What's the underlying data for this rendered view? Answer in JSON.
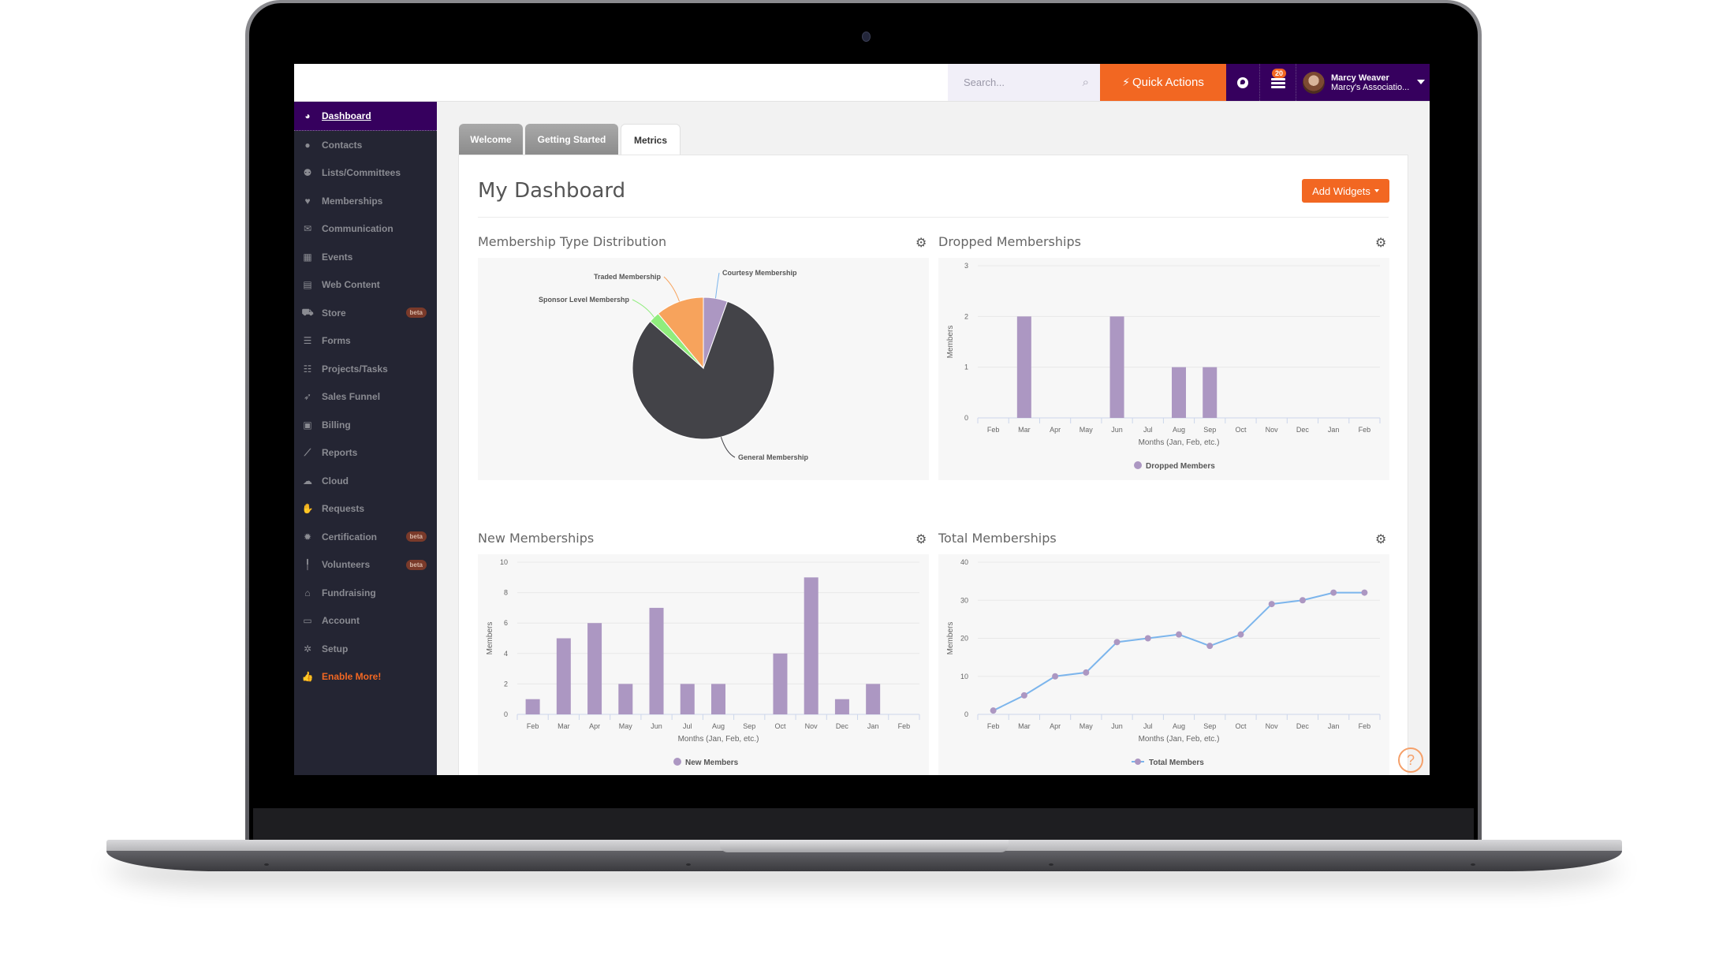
{
  "header": {
    "search_placeholder": "Search...",
    "search_icon": "magnifier-icon",
    "quick_actions_label": "Quick Actions",
    "quick_actions_icon": "bolt-icon",
    "globe_icon": "globe-icon",
    "notifications_icon": "tasks-stack-icon",
    "notifications_count": "20",
    "user": {
      "name": "Marcy Weaver",
      "organization": "Marcy's Associatio..."
    },
    "colors": {
      "accent": "#f26722",
      "brand": "#36005e"
    }
  },
  "sidebar": {
    "items": [
      {
        "label": "Dashboard",
        "icon": "dashboard-gauge-icon",
        "glyph": "◕",
        "active": true
      },
      {
        "label": "Contacts",
        "icon": "user-icon",
        "glyph": "●"
      },
      {
        "label": "Lists/Committees",
        "icon": "users-icon",
        "glyph": "⚉"
      },
      {
        "label": "Memberships",
        "icon": "heart-icon",
        "glyph": "♥"
      },
      {
        "label": "Communication",
        "icon": "envelope-icon",
        "glyph": "✉"
      },
      {
        "label": "Events",
        "icon": "calendar-icon",
        "glyph": "▦"
      },
      {
        "label": "Web Content",
        "icon": "newspaper-icon",
        "glyph": "▤"
      },
      {
        "label": "Store",
        "icon": "cart-icon",
        "glyph": "⛟",
        "badge": "beta"
      },
      {
        "label": "Forms",
        "icon": "list-icon",
        "glyph": "☰"
      },
      {
        "label": "Projects/Tasks",
        "icon": "tasks-icon",
        "glyph": "☷"
      },
      {
        "label": "Sales Funnel",
        "icon": "rocket-icon",
        "glyph": "➶"
      },
      {
        "label": "Billing",
        "icon": "money-icon",
        "glyph": "▣"
      },
      {
        "label": "Reports",
        "icon": "line-chart-icon",
        "glyph": "⟋"
      },
      {
        "label": "Cloud",
        "icon": "cloud-icon",
        "glyph": "☁"
      },
      {
        "label": "Requests",
        "icon": "hand-icon",
        "glyph": "✋"
      },
      {
        "label": "Certification",
        "icon": "certificate-icon",
        "glyph": "✹",
        "badge": "beta"
      },
      {
        "label": "Volunteers",
        "icon": "volunteer-icon",
        "glyph": "╿",
        "badge": "beta"
      },
      {
        "label": "Fundraising",
        "icon": "gift-icon",
        "glyph": "⌂"
      },
      {
        "label": "Account",
        "icon": "credit-card-icon",
        "glyph": "▭"
      },
      {
        "label": "Setup",
        "icon": "gear-icon",
        "glyph": "✲"
      },
      {
        "label": "Enable More!",
        "icon": "thumbs-up-icon",
        "glyph": "👍",
        "highlight": true
      }
    ]
  },
  "tabs": [
    {
      "label": "Welcome",
      "active": false
    },
    {
      "label": "Getting Started",
      "active": false
    },
    {
      "label": "Metrics",
      "active": true
    }
  ],
  "main": {
    "title": "My Dashboard",
    "add_widgets_label": "Add Widgets",
    "help_label": "?"
  },
  "chart_data": [
    {
      "type": "pie",
      "title": "Membership Type Distribution",
      "slices": [
        {
          "label": "Courtesy Membership",
          "value": 5.5,
          "color": "#ac97c2"
        },
        {
          "label": "General Membership",
          "value": 81,
          "color": "#434348"
        },
        {
          "label": "Sponsor Level Membershp",
          "value": 2.5,
          "color": "#90ed7d"
        },
        {
          "label": "Traded Membership",
          "value": 11,
          "color": "#f7a35c"
        }
      ]
    },
    {
      "type": "bar",
      "title": "Dropped Memberships",
      "categories": [
        "Feb",
        "Mar",
        "Apr",
        "May",
        "Jun",
        "Jul",
        "Aug",
        "Sep",
        "Oct",
        "Nov",
        "Dec",
        "Jan",
        "Feb"
      ],
      "series": [
        {
          "name": "Dropped Members",
          "values": [
            0,
            2,
            0,
            0,
            2,
            0,
            1,
            1,
            0,
            0,
            0,
            0,
            0
          ],
          "color": "#ac97c2"
        }
      ],
      "xlabel": "Months (Jan, Feb, etc.)",
      "ylabel": "Members",
      "ylim": [
        0,
        3
      ],
      "yticks": [
        0,
        1,
        2,
        3
      ],
      "grid": true,
      "legend": "bottom-center"
    },
    {
      "type": "bar",
      "title": "New Memberships",
      "categories": [
        "Feb",
        "Mar",
        "Apr",
        "May",
        "Jun",
        "Jul",
        "Aug",
        "Sep",
        "Oct",
        "Nov",
        "Dec",
        "Jan",
        "Feb"
      ],
      "series": [
        {
          "name": "New Members",
          "values": [
            1,
            5,
            6,
            2,
            7,
            2,
            2,
            0,
            4,
            9,
            1,
            2,
            0
          ],
          "color": "#ac97c2"
        }
      ],
      "xlabel": "Months (Jan, Feb, etc.)",
      "ylabel": "Members",
      "ylim": [
        0,
        10
      ],
      "yticks": [
        0,
        2,
        4,
        6,
        8,
        10
      ],
      "grid": true,
      "legend": "bottom-center"
    },
    {
      "type": "line",
      "title": "Total Memberships",
      "categories": [
        "Feb",
        "Mar",
        "Apr",
        "May",
        "Jun",
        "Jul",
        "Aug",
        "Sep",
        "Oct",
        "Nov",
        "Dec",
        "Jan",
        "Feb"
      ],
      "series": [
        {
          "name": "Total Members",
          "values": [
            1,
            5,
            10,
            11,
            19,
            20,
            21,
            18,
            21,
            29,
            30,
            32,
            32
          ],
          "color": "#7cb5ec",
          "marker_color": "#ac97c2"
        }
      ],
      "xlabel": "Months (Jan, Feb, etc.)",
      "ylabel": "Members",
      "ylim": [
        0,
        40
      ],
      "yticks": [
        0,
        10,
        20,
        30,
        40
      ],
      "grid": true,
      "legend": "bottom-center"
    }
  ]
}
